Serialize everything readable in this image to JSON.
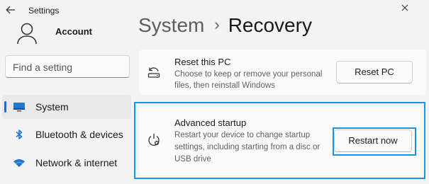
{
  "window": {
    "title": "Settings"
  },
  "account": {
    "name": "Account"
  },
  "search": {
    "placeholder": "Find a setting"
  },
  "nav": [
    {
      "label": "System",
      "icon": "monitor-icon"
    },
    {
      "label": "Bluetooth & devices",
      "icon": "bluetooth-icon"
    },
    {
      "label": "Network & internet",
      "icon": "wifi-icon"
    }
  ],
  "breadcrumb": {
    "parent": "System",
    "separator": "›",
    "current": "Recovery"
  },
  "reset": {
    "title": "Reset this PC",
    "description_line1": "Choose to keep or remove your personal",
    "description_line2": "files, then reinstall Windows",
    "button": "Reset PC"
  },
  "advanced": {
    "title": "Advanced startup",
    "description_line1": "Restart your device to change startup",
    "description_line2": "settings, including starting from a disc or",
    "description_line3": "USB drive",
    "button": "Restart now"
  },
  "colors": {
    "accent": "#1e6ec8",
    "highlight": "#1795e1"
  }
}
